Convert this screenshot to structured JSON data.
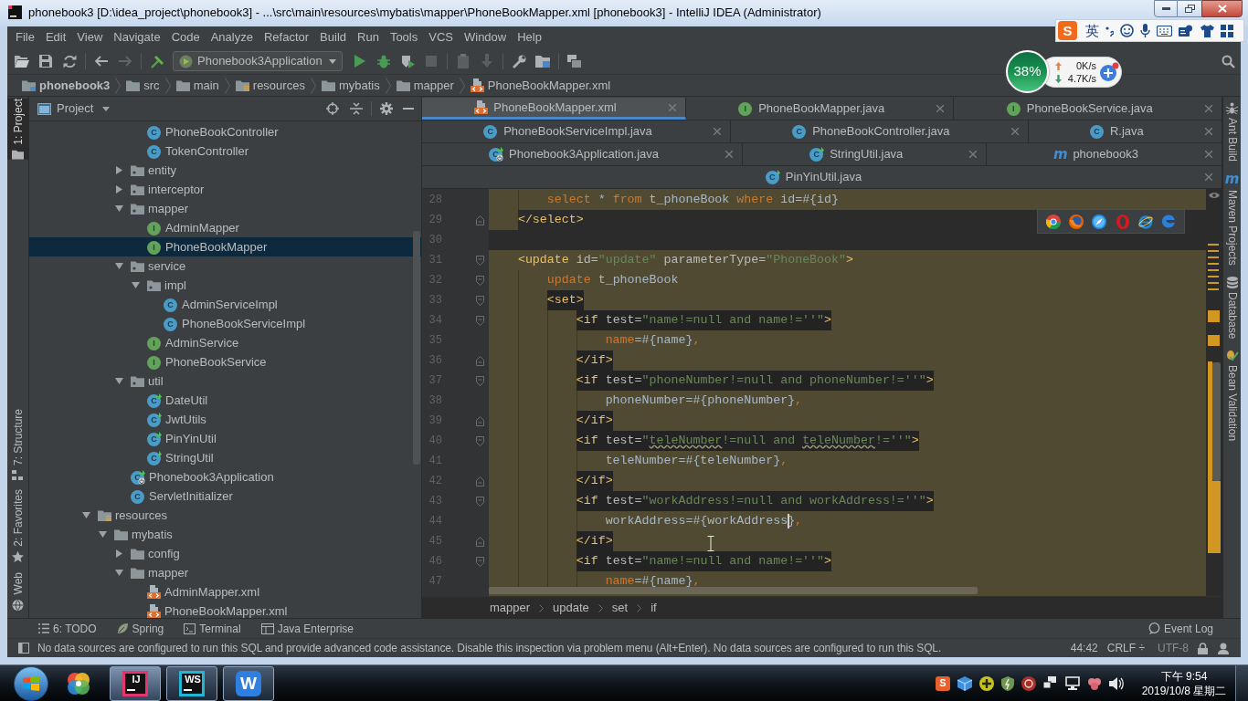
{
  "window": {
    "title": "phonebook3 [D:\\idea_project\\phonebook3] - ...\\src\\main\\resources\\mybatis\\mapper\\PhoneBookMapper.xml [phonebook3] - IntelliJ IDEA (Administrator)"
  },
  "menu": [
    "File",
    "Edit",
    "View",
    "Navigate",
    "Code",
    "Analyze",
    "Refactor",
    "Build",
    "Run",
    "Tools",
    "VCS",
    "Window",
    "Help"
  ],
  "ime_bar": {
    "logo": "S",
    "mode": "英"
  },
  "toolbar": {
    "run_configuration": "Phonebook3Application"
  },
  "network_monitor": {
    "usage": "38%",
    "upload": "0K/s",
    "download": "4.7K/s"
  },
  "navigation_bar": [
    {
      "label": "phonebook3",
      "kind": "module"
    },
    {
      "label": "src",
      "kind": "folder"
    },
    {
      "label": "main",
      "kind": "folder"
    },
    {
      "label": "resources",
      "kind": "resources"
    },
    {
      "label": "mybatis",
      "kind": "folder"
    },
    {
      "label": "mapper",
      "kind": "folder"
    },
    {
      "label": "PhoneBookMapper.xml",
      "kind": "xml"
    }
  ],
  "left_tool_strip": [
    {
      "label": "1: Project",
      "kind": "project",
      "selected": true
    },
    {
      "label": "7: Structure",
      "kind": "structure",
      "selected": false
    },
    {
      "label": "2: Favorites",
      "kind": "favorites",
      "selected": false
    },
    {
      "label": "Web",
      "kind": "web",
      "selected": false
    }
  ],
  "project_panel": {
    "title": "Project",
    "tree": [
      {
        "children": [
          {
            "children": [
              {
                "children": [
                  {
                    "label": "PhoneBookController",
                    "kind": "class",
                    "badge": "C",
                    "selected": false
                  },
                  {
                    "label": "TokenController",
                    "kind": "class",
                    "badge": "C",
                    "selected": false
                  }
                ]
              },
              {
                "label": "entity",
                "kind": "package",
                "expanded": false,
                "selected": false
              },
              {
                "label": "interceptor",
                "kind": "package",
                "expanded": false,
                "selected": false
              },
              {
                "label": "mapper",
                "kind": "package",
                "expanded": true,
                "selected": false,
                "children": [
                  {
                    "label": "AdminMapper",
                    "kind": "interface",
                    "badge": "I",
                    "selected": false
                  },
                  {
                    "label": "PhoneBookMapper",
                    "kind": "interface",
                    "badge": "I",
                    "selected": true
                  }
                ]
              },
              {
                "label": "service",
                "kind": "package",
                "expanded": true,
                "selected": false,
                "children": [
                  {
                    "label": "impl",
                    "kind": "package",
                    "expanded": true,
                    "selected": false,
                    "children": [
                      {
                        "label": "AdminServiceImpl",
                        "kind": "class",
                        "badge": "C",
                        "selected": false
                      },
                      {
                        "label": "PhoneBookServiceImpl",
                        "kind": "class",
                        "badge": "C",
                        "selected": false
                      }
                    ]
                  },
                  {
                    "label": "AdminService",
                    "kind": "interface",
                    "badge": "I",
                    "selected": false
                  },
                  {
                    "label": "PhoneBookService",
                    "kind": "interface",
                    "badge": "I",
                    "selected": false
                  }
                ]
              },
              {
                "label": "util",
                "kind": "package",
                "expanded": true,
                "selected": false,
                "children": [
                  {
                    "label": "DateUtil",
                    "kind": "util-class",
                    "badge": "C",
                    "selected": false
                  },
                  {
                    "label": "JwtUtils",
                    "kind": "util-class",
                    "badge": "C",
                    "selected": false
                  },
                  {
                    "label": "PinYinUtil",
                    "kind": "util-class",
                    "badge": "C",
                    "selected": false
                  },
                  {
                    "label": "StringUtil",
                    "kind": "util-class",
                    "badge": "C",
                    "selected": false
                  }
                ]
              },
              {
                "label": "Phonebook3Application",
                "kind": "spring-app",
                "badge": "C",
                "selected": false
              },
              {
                "label": "ServletInitializer",
                "kind": "class",
                "badge": "C",
                "selected": false
              }
            ]
          }
        ]
      },
      {
        "label": "resources",
        "kind": "resources",
        "expanded": true,
        "selected": false,
        "children": [
          {
            "label": "mybatis",
            "kind": "folder",
            "expanded": true,
            "selected": false,
            "children": [
              {
                "label": "config",
                "kind": "folder",
                "expanded": false,
                "selected": false
              },
              {
                "label": "mapper",
                "kind": "folder",
                "expanded": true,
                "selected": false,
                "children": [
                  {
                    "label": "AdminMapper.xml",
                    "kind": "xml",
                    "selected": false
                  },
                  {
                    "label": "PhoneBookMapper.xml",
                    "kind": "xml",
                    "selected": false
                  }
                ]
              }
            ]
          }
        ]
      }
    ]
  },
  "editor_tabs": {
    "rows": [
      {
        "tabs": [
          {
            "label": "PhoneBookMapper.xml",
            "kind": "xml",
            "selected": true
          },
          {
            "label": "PhoneBookMapper.java",
            "kind": "interface",
            "badge": "I",
            "selected": false
          },
          {
            "label": "PhoneBookService.java",
            "kind": "interface",
            "badge": "I",
            "selected": false
          }
        ]
      },
      {
        "tabs": [
          {
            "label": "PhoneBookServiceImpl.java",
            "kind": "class",
            "badge": "C",
            "selected": false
          },
          {
            "label": "PhoneBookController.java",
            "kind": "class",
            "badge": "C",
            "selected": false
          },
          {
            "label": "R.java",
            "kind": "class",
            "badge": "C",
            "selected": false
          }
        ]
      },
      {
        "tabs": [
          {
            "label": "Phonebook3Application.java",
            "kind": "spring-app",
            "badge": "C",
            "selected": false
          },
          {
            "label": "StringUtil.java",
            "kind": "util-class",
            "badge": "C",
            "selected": false
          },
          {
            "label": "phonebook3",
            "kind": "maven",
            "badge": "m",
            "selected": false
          }
        ]
      },
      {
        "tabs": [
          {
            "label": "PinYinUtil.java",
            "kind": "util-class",
            "badge": "C",
            "selected": false
          }
        ]
      }
    ]
  },
  "editor": {
    "lines": [
      {
        "number": "28",
        "kind": "full",
        "chip": false,
        "tokens": [
          {
            "kind": "keyword",
            "text": "        select"
          },
          {
            "kind": "text",
            "text": " * "
          },
          {
            "kind": "keyword",
            "text": "from"
          },
          {
            "kind": "text",
            "text": " t_phoneBook "
          },
          {
            "kind": "keyword",
            "text": "where"
          },
          {
            "kind": "text",
            "text": " id=#{id}"
          }
        ]
      },
      {
        "number": "29",
        "kind": "indent",
        "fold": {
          "kind": "end"
        },
        "tokens": [
          {
            "kind": "tag",
            "text": "    </select>"
          }
        ]
      },
      {
        "number": "30",
        "kind": "plain"
      },
      {
        "number": "31",
        "kind": "full",
        "chip": false,
        "fold": {
          "kind": "start"
        },
        "tokens": [
          {
            "kind": "tag",
            "text": "    <update"
          },
          {
            "kind": "attr",
            "text": " id="
          },
          {
            "kind": "value",
            "text": "\"update\""
          },
          {
            "kind": "attr",
            "text": " parameterType="
          },
          {
            "kind": "value",
            "text": "\"PhoneBook\""
          },
          {
            "kind": "tag",
            "text": ">"
          }
        ]
      },
      {
        "number": "32",
        "kind": "full",
        "chip": false,
        "fold": {
          "kind": "start"
        },
        "tokens": [
          {
            "kind": "keyword",
            "text": "        update"
          },
          {
            "kind": "text",
            "text": " t_phoneBook"
          }
        ]
      },
      {
        "number": "33",
        "kind": "full",
        "chip": true,
        "fold": {
          "kind": "start"
        },
        "tokens": [
          {
            "kind": "tag",
            "text": "        <set>"
          }
        ]
      },
      {
        "number": "34",
        "kind": "full",
        "chip": true,
        "fold": {
          "kind": "start"
        },
        "tokens": [
          {
            "kind": "tag",
            "text": "            <if"
          },
          {
            "kind": "attr",
            "text": " test="
          },
          {
            "kind": "value",
            "text": "\"name!=null and name!=''\""
          },
          {
            "kind": "tag",
            "text": ">"
          }
        ]
      },
      {
        "number": "35",
        "kind": "full",
        "chip": false,
        "tokens": [
          {
            "kind": "keyword",
            "text": "                name"
          },
          {
            "kind": "text",
            "text": "=#{name}"
          },
          {
            "kind": "keyword",
            "text": ","
          }
        ]
      },
      {
        "number": "36",
        "kind": "full",
        "chip": true,
        "fold": {
          "kind": "end"
        },
        "tokens": [
          {
            "kind": "tag",
            "text": "            </if>"
          }
        ]
      },
      {
        "number": "37",
        "kind": "full",
        "chip": true,
        "fold": {
          "kind": "start"
        },
        "tokens": [
          {
            "kind": "tag",
            "text": "            <if"
          },
          {
            "kind": "attr",
            "text": " test="
          },
          {
            "kind": "value",
            "text": "\"phoneNumber!=null and phoneNumber!=''\""
          },
          {
            "kind": "tag",
            "text": ">"
          }
        ]
      },
      {
        "number": "38",
        "kind": "full",
        "chip": false,
        "tokens": [
          {
            "kind": "text",
            "text": "                phoneNumber=#{phoneNumber}"
          },
          {
            "kind": "keyword",
            "text": ","
          }
        ]
      },
      {
        "number": "39",
        "kind": "full",
        "chip": true,
        "fold": {
          "kind": "end"
        },
        "tokens": [
          {
            "kind": "tag",
            "text": "            </if>"
          }
        ]
      },
      {
        "number": "40",
        "kind": "full",
        "chip": true,
        "fold": {
          "kind": "start"
        },
        "tokens": [
          {
            "kind": "tag",
            "text": "            <if"
          },
          {
            "kind": "attr",
            "text": " test="
          },
          {
            "kind": "value",
            "text": "\""
          },
          {
            "kind": "typo",
            "text": "teleNumber"
          },
          {
            "kind": "value",
            "text": "!=null and "
          },
          {
            "kind": "typo",
            "text": "teleNumber"
          },
          {
            "kind": "value",
            "text": "!=''\""
          },
          {
            "kind": "tag",
            "text": ">"
          }
        ]
      },
      {
        "number": "41",
        "kind": "full",
        "chip": false,
        "tokens": [
          {
            "kind": "text",
            "text": "                teleNumber=#{teleNumber}"
          },
          {
            "kind": "keyword",
            "text": ","
          }
        ]
      },
      {
        "number": "42",
        "kind": "full",
        "chip": true,
        "fold": {
          "kind": "end"
        },
        "tokens": [
          {
            "kind": "tag",
            "text": "            </if>"
          }
        ]
      },
      {
        "number": "43",
        "kind": "full",
        "chip": true,
        "fold": {
          "kind": "start"
        },
        "tokens": [
          {
            "kind": "tag",
            "text": "            <if"
          },
          {
            "kind": "attr",
            "text": " test="
          },
          {
            "kind": "value",
            "text": "\"workAddress!=null and workAddress!=''\""
          },
          {
            "kind": "tag",
            "text": ">"
          }
        ]
      },
      {
        "number": "44",
        "kind": "full",
        "chip": false,
        "tokens": [
          {
            "kind": "text",
            "text": "                workAddress=#{workAddress",
            "caret": true
          },
          {
            "kind": "text",
            "text": "}",
            "caret": false
          },
          {
            "kind": "keyword",
            "text": ",",
            "caret": false
          }
        ]
      },
      {
        "number": "45",
        "kind": "full",
        "chip": true,
        "fold": {
          "kind": "end"
        },
        "tokens": [
          {
            "kind": "tag",
            "text": "            </if>"
          }
        ]
      },
      {
        "number": "46",
        "kind": "full",
        "chip": true,
        "fold": {
          "kind": "start"
        },
        "tokens": [
          {
            "kind": "tag",
            "text": "            <if"
          },
          {
            "kind": "attr",
            "text": " test="
          },
          {
            "kind": "value",
            "text": "\"name!=null and name!=''\""
          },
          {
            "kind": "tag",
            "text": ">"
          }
        ]
      },
      {
        "number": "47",
        "kind": "full",
        "chip": false,
        "tokens": [
          {
            "kind": "keyword",
            "text": "                name"
          },
          {
            "kind": "text",
            "text": "=#{name}"
          },
          {
            "kind": "keyword",
            "text": ","
          }
        ]
      }
    ],
    "breadcrumb": [
      "mapper",
      "update",
      "set",
      "if"
    ]
  },
  "right_tool_strip": [
    {
      "label": "Ant Build",
      "kind": "ant",
      "selected": false
    },
    {
      "label": "Maven Projects",
      "kind": "maven",
      "badge": "m",
      "selected": false
    },
    {
      "label": "Database",
      "kind": "database",
      "selected": false
    },
    {
      "label": "Bean Validation",
      "kind": "bean",
      "selected": false
    }
  ],
  "bottom_tool_bar": {
    "tool_windows": [
      {
        "label": "6: TODO",
        "kind": "todo",
        "selected": false
      },
      {
        "label": "Spring",
        "kind": "spring",
        "selected": false
      },
      {
        "label": "Terminal",
        "kind": "terminal",
        "selected": false
      },
      {
        "label": "Java Enterprise",
        "kind": "javaee",
        "selected": false
      }
    ],
    "event_log": "Event Log"
  },
  "status_bar": {
    "message": "No data sources are configured to run this SQL and provide advanced code assistance. Disable this inspection via problem menu (Alt+Enter). No data sources are configured to run this SQL.",
    "caret_position": "44:42",
    "line_separator": "CRLF ÷",
    "encoding": "UTF-8"
  },
  "taskbar": {
    "apps": [
      {
        "kind": "flower",
        "running": false,
        "selected": false
      },
      {
        "kind": "ij",
        "logo": "IJ",
        "running": true,
        "selected": true
      },
      {
        "kind": "ws",
        "logo": "WS",
        "running": true,
        "selected": false
      },
      {
        "kind": "w",
        "logo": "W",
        "running": true,
        "selected": false
      }
    ],
    "tray_logo": "S",
    "clock": {
      "time": "下午 9:54",
      "date": "2019/10/8 星期二"
    }
  }
}
